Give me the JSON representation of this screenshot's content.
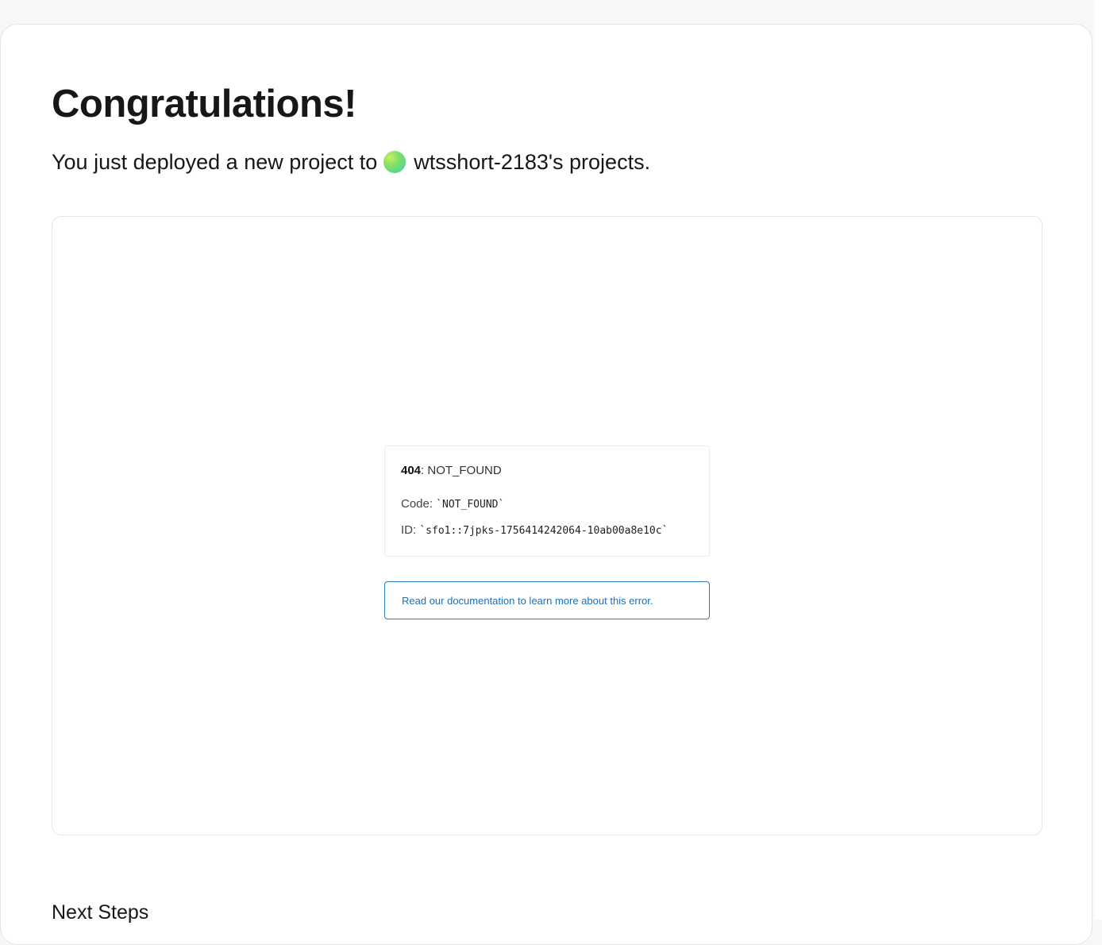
{
  "page": {
    "title": "Congratulations!",
    "subtitle_prefix": "You just deployed a new project to",
    "team_name": "wtsshort-2183's projects.",
    "next_steps_label": "Next Steps"
  },
  "preview": {
    "error_code_number": "404",
    "error_code_text": ": NOT_FOUND",
    "code_label": "Code:",
    "code_value": "`NOT_FOUND`",
    "id_label": "ID:",
    "id_value": "`sfo1::7jpks-1756414242064-10ab00a8e10c`",
    "doc_link_text": "Read our documentation to learn more about this error."
  },
  "colors": {
    "background": "#f7f7f7",
    "card": "#ffffff",
    "link": "#1f6fb5",
    "link_border": "#2f7bbf"
  },
  "icons": {
    "team_avatar": "gradient-circle-avatar"
  }
}
